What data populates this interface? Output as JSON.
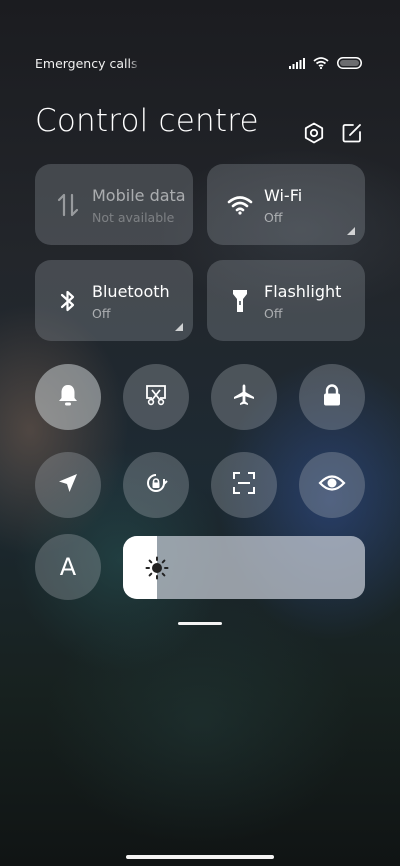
{
  "status_bar": {
    "carrier_text": "Emergency calls only",
    "icons": [
      "signal-icon",
      "wifi-icon",
      "battery-icon"
    ]
  },
  "header": {
    "title": "Control centre",
    "icons": [
      "settings-icon",
      "edit-icon"
    ]
  },
  "tiles": [
    {
      "name": "mobile-data",
      "label": "Mobile data",
      "status": "Not available",
      "icon": "mobile-data-icon",
      "enabled": false
    },
    {
      "name": "wifi",
      "label": "Wi-Fi",
      "status": "Off",
      "icon": "wifi-icon",
      "enabled": true
    },
    {
      "name": "bluetooth",
      "label": "Bluetooth",
      "status": "Off",
      "icon": "bluetooth-icon",
      "enabled": true
    },
    {
      "name": "flashlight",
      "label": "Flashlight",
      "status": "Off",
      "icon": "flashlight-icon",
      "enabled": true
    }
  ],
  "toggles_row1": [
    "bell-icon",
    "screenshot-icon",
    "airplane-icon",
    "lock-icon"
  ],
  "toggles_row2": [
    "location-icon",
    "rotation-lock-icon",
    "scanner-icon",
    "eye-icon"
  ],
  "auto_brightness": {
    "letter": "A",
    "icon": "auto-brightness-icon"
  },
  "brightness": {
    "icon": "sun-icon",
    "level": 0.14
  },
  "colors": {
    "tile_bg": "#8e979c",
    "slider_track": "#c8cdd7",
    "slider_fill": "#ffffff"
  }
}
